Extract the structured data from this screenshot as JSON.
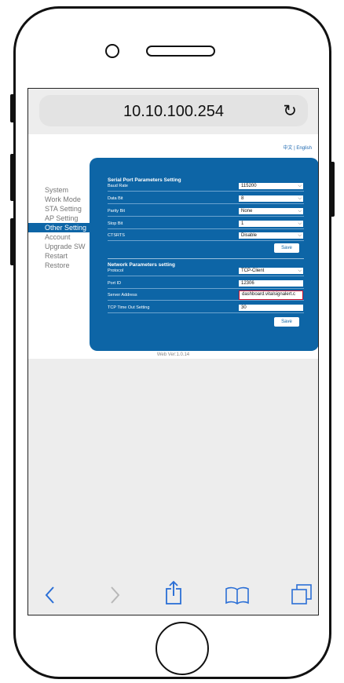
{
  "browser": {
    "url": "10.10.100.254"
  },
  "lang": {
    "chinese": "中文",
    "sep": "|",
    "english": "English"
  },
  "nav": [
    "System",
    "Work Mode",
    "STA Setting",
    "AP Setting",
    "Other Setting",
    "Account",
    "Upgrade SW",
    "Restart",
    "Restore"
  ],
  "serial": {
    "title": "Serial Port Parameters Setting",
    "rows": [
      {
        "label": "Baud Rate",
        "value": "115200"
      },
      {
        "label": "Data Bit",
        "value": "8"
      },
      {
        "label": "Parity Bit",
        "value": "None"
      },
      {
        "label": "Stop Bit",
        "value": "1"
      },
      {
        "label": "CTSRTS",
        "value": "Disable"
      }
    ],
    "save": "Save"
  },
  "network": {
    "title": "Network Parameters setting",
    "rows": [
      {
        "label": "Protocol",
        "value": "TCP-Client"
      },
      {
        "label": "Port ID",
        "value": "12306"
      },
      {
        "label": "Server Address",
        "value": "dashboard.vitalsignalert.c"
      },
      {
        "label": "TCP Time Out Setting",
        "value": "30"
      }
    ],
    "save": "Save"
  },
  "footer": {
    "version": "Web Ver:1.0.14"
  },
  "colors": {
    "panel": "#0d65a6",
    "highlight": "#c8102e"
  }
}
